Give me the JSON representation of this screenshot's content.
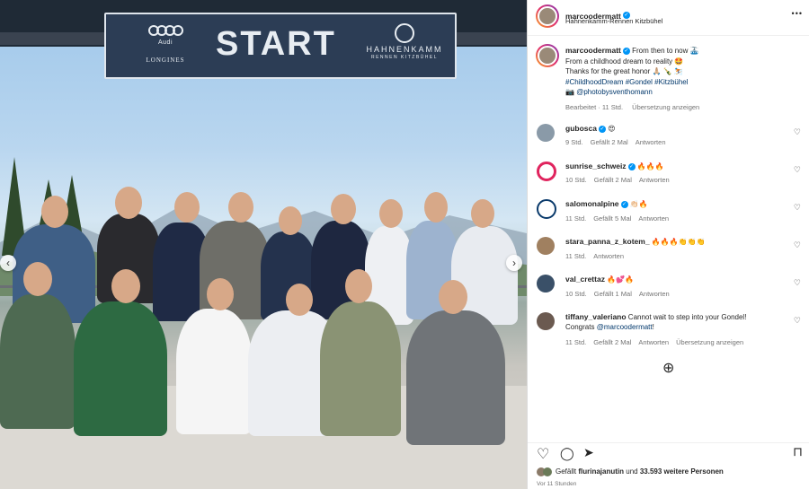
{
  "photo": {
    "banner": {
      "left_brand": "Audi",
      "left_brand2": "LONGINES",
      "title": "START",
      "right_brand": "HAHNENKAMM",
      "right_brand2": "RENNEN KITZBÜHEL"
    },
    "prev_arrow": "‹",
    "next_arrow": "›"
  },
  "post": {
    "username": "marcoodermatt",
    "location": "Hahnenkamm-Rennen Kitzbühel",
    "more": "•••",
    "caption": {
      "username": "marcoodermatt",
      "line1": "From then to now 🚠",
      "line2": "From a childhood dream to reality 🤩",
      "line3": "Thanks for the great honor 🙏🏼 🍾 ⛷️",
      "hashtags": "#ChildhoodDream #Gondel #Kitzbühel",
      "photo_credit_prefix": "📷",
      "photo_credit": "@photobysventhomann",
      "meta_edited": "Bearbeitet · 11 Std.",
      "meta_translate": "Übersetzung anzeigen"
    }
  },
  "comments": [
    {
      "username": "gubosca",
      "verified": true,
      "text": "😍",
      "time": "9 Std.",
      "likes": "Gefällt 2 Mal",
      "reply": "Antworten",
      "avatar_color": "#8a9aa8"
    },
    {
      "username": "sunrise_schweiz",
      "verified": true,
      "text": "🔥🔥🔥",
      "time": "10 Std.",
      "likes": "Gefällt 2 Mal",
      "reply": "Antworten",
      "avatar_color": "#e0245e"
    },
    {
      "username": "salomonalpine",
      "verified": true,
      "text": "👏🏻🔥",
      "time": "11 Std.",
      "likes": "Gefällt 5 Mal",
      "reply": "Antworten",
      "avatar_color": "#0a3a6b"
    },
    {
      "username": "stara_panna_z_kotem_",
      "verified": false,
      "text": "🔥🔥🔥👏👏👏",
      "time": "11 Std.",
      "likes": "",
      "reply": "Antworten",
      "avatar_color": "#a08060"
    },
    {
      "username": "val_crettaz",
      "verified": false,
      "text": "🔥💕🔥",
      "time": "10 Std.",
      "likes": "Gefällt 1 Mal",
      "reply": "Antworten",
      "avatar_color": "#3a5068"
    },
    {
      "username": "tiffany_valeriano",
      "verified": false,
      "text": "Cannot wait to step into your Gondel!",
      "text2_prefix": "Congrats",
      "mention": "@marcoodermatt",
      "text2_suffix": "!",
      "time": "11 Std.",
      "likes": "Gefällt 2 Mal",
      "reply": "Antworten",
      "translate": "Übersetzung anzeigen",
      "avatar_color": "#6b5a50"
    }
  ],
  "load_more": "⊕",
  "actions": {
    "like": "♡",
    "comment": "◯",
    "share": "➤",
    "save": "⊓"
  },
  "likes": {
    "prefix": "Gefällt",
    "user": "flurinajanutin",
    "middle": "und",
    "count": "33.593 weitere Personen"
  },
  "time_ago": "Vor 11 Stunden",
  "colors": {
    "link": "#00376b",
    "verified": "#0095f6",
    "meta": "#737373",
    "banner": "#2c3d55"
  }
}
